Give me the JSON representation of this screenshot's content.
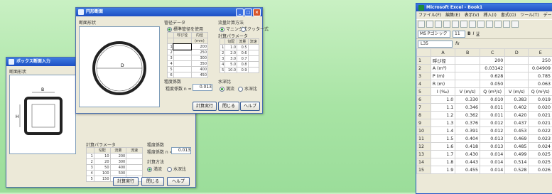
{
  "dialog_back": {
    "title": "ボックス断面入力",
    "section_label": "断面形状",
    "dim_b": "B",
    "dim_h": "H",
    "table_label": "計算パラメータ",
    "table_headers": [
      "勾配",
      "流量",
      "流速"
    ],
    "rows": [
      [
        "1",
        "10",
        "200"
      ],
      [
        "2",
        "20",
        "300"
      ],
      [
        "3",
        "50",
        "400"
      ],
      [
        "4",
        "100",
        "500"
      ],
      [
        "5",
        "150",
        "600"
      ]
    ],
    "coef_label": "粗度係数",
    "coef_field_label": "粗度係数 n =",
    "coef_field_value": "0.013",
    "opt_label": "計算方法",
    "opt_a": "満流",
    "opt_b": "水深比",
    "ok": "計算実行",
    "cancel": "閉じる",
    "help": "ヘルプ"
  },
  "dialog_front": {
    "title": "円形断面",
    "section_label": "断面形状",
    "dim_d": "D",
    "conduit_label": "管径データ",
    "conduit_check": "標準管径を使用",
    "conduit_headers": [
      "呼び径",
      "内径"
    ],
    "conduit_unit": "(mm)",
    "conduit_rows": [
      [
        "1",
        "200"
      ],
      [
        "2",
        "250"
      ],
      [
        "3",
        "300"
      ],
      [
        "4",
        "350"
      ],
      [
        "5",
        "400"
      ],
      [
        "6",
        "450"
      ]
    ],
    "flow_label": "流量計算方法",
    "flow_a": "マニング式",
    "flow_b": "クッター式",
    "calc_label": "計算パラメータ",
    "calc_headers": [
      "勾配",
      "流量",
      "流速"
    ],
    "calc_rows": [
      [
        "1",
        "1.0",
        "0.5"
      ],
      [
        "2",
        "2.0",
        "0.6"
      ],
      [
        "3",
        "3.0",
        "0.7"
      ],
      [
        "4",
        "5.0",
        "0.8"
      ],
      [
        "5",
        "10.0",
        "0.9"
      ]
    ],
    "coef_label": "粗度係数",
    "coef_field_label": "粗度係数 n =",
    "coef_field_value": "0.013",
    "depth_label": "水深比",
    "depth_a": "満流",
    "depth_b": "水深比",
    "ok": "計算実行",
    "cancel": "閉じる",
    "help": "ヘルプ"
  },
  "excel": {
    "title": "Microsoft Excel - Book1",
    "menu": [
      "ファイル(F)",
      "編集(E)",
      "表示(V)",
      "挿入(I)",
      "書式(O)",
      "ツール(T)",
      "データ"
    ],
    "font_name": "MS Pゴシック",
    "font_size": "11",
    "name_box": "L35",
    "fx": "fx",
    "columns": [
      "",
      "A",
      "B",
      "C",
      "D",
      "E"
    ],
    "rows": [
      [
        "1",
        "呼び径",
        "",
        "200",
        "",
        "250"
      ],
      [
        "2",
        "A (m²)",
        "",
        "0.03142",
        "",
        "0.04909"
      ],
      [
        "3",
        "P (m)",
        "",
        "0.628",
        "",
        "0.785"
      ],
      [
        "4",
        "R (m)",
        "",
        "0.050",
        "",
        "0.063"
      ],
      [
        "5",
        "I (‰)",
        "V (m/s)",
        "Q (m³/s)",
        "V (m/s)",
        "Q (m³/s)"
      ],
      [
        "6",
        "1.0",
        "0.330",
        "0.010",
        "0.383",
        "0.019"
      ],
      [
        "7",
        "1.1",
        "0.346",
        "0.011",
        "0.402",
        "0.020"
      ],
      [
        "8",
        "1.2",
        "0.362",
        "0.011",
        "0.420",
        "0.021"
      ],
      [
        "9",
        "1.3",
        "0.376",
        "0.012",
        "0.437",
        "0.021"
      ],
      [
        "10",
        "1.4",
        "0.391",
        "0.012",
        "0.453",
        "0.022"
      ],
      [
        "11",
        "1.5",
        "0.404",
        "0.013",
        "0.469",
        "0.023"
      ],
      [
        "12",
        "1.6",
        "0.418",
        "0.013",
        "0.485",
        "0.024"
      ],
      [
        "13",
        "1.7",
        "0.430",
        "0.014",
        "0.499",
        "0.025"
      ],
      [
        "14",
        "1.8",
        "0.443",
        "0.014",
        "0.514",
        "0.025"
      ],
      [
        "15",
        "1.9",
        "0.455",
        "0.014",
        "0.528",
        "0.026"
      ]
    ]
  }
}
